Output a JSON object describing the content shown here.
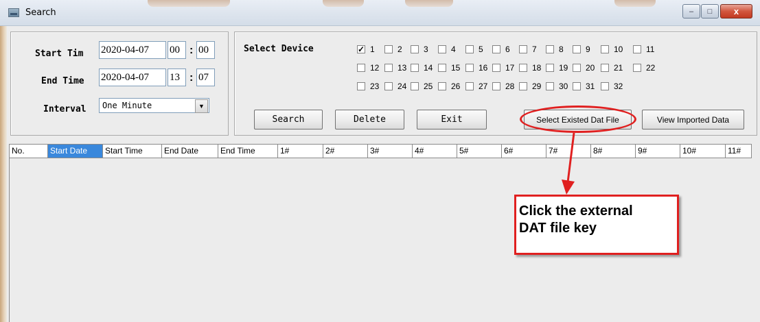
{
  "window": {
    "title": "Search",
    "minimize": "–",
    "maximize": "□",
    "close": "x"
  },
  "time_panel": {
    "start_label": "Start Tim",
    "start_date": "2020-04-07",
    "start_hour": "00",
    "start_minute": "00",
    "end_label": "End Time",
    "end_date": "2020-04-07",
    "end_hour": "13",
    "end_minute": "07",
    "colon": ":",
    "interval_label": "Interval",
    "interval_value": "One Minute",
    "dropdown_arrow": "▼"
  },
  "device_panel": {
    "label": "Select Device",
    "devices": [
      {
        "n": "1",
        "checked": true
      },
      {
        "n": "2",
        "checked": false
      },
      {
        "n": "3",
        "checked": false
      },
      {
        "n": "4",
        "checked": false
      },
      {
        "n": "5",
        "checked": false
      },
      {
        "n": "6",
        "checked": false
      },
      {
        "n": "7",
        "checked": false
      },
      {
        "n": "8",
        "checked": false
      },
      {
        "n": "9",
        "checked": false
      },
      {
        "n": "10",
        "checked": false
      },
      {
        "n": "11",
        "checked": false
      },
      {
        "n": "12",
        "checked": false
      },
      {
        "n": "13",
        "checked": false
      },
      {
        "n": "14",
        "checked": false
      },
      {
        "n": "15",
        "checked": false
      },
      {
        "n": "16",
        "checked": false
      },
      {
        "n": "17",
        "checked": false
      },
      {
        "n": "18",
        "checked": false
      },
      {
        "n": "19",
        "checked": false
      },
      {
        "n": "20",
        "checked": false
      },
      {
        "n": "21",
        "checked": false
      },
      {
        "n": "22",
        "checked": false
      },
      {
        "n": "23",
        "checked": false
      },
      {
        "n": "24",
        "checked": false
      },
      {
        "n": "25",
        "checked": false
      },
      {
        "n": "26",
        "checked": false
      },
      {
        "n": "27",
        "checked": false
      },
      {
        "n": "28",
        "checked": false
      },
      {
        "n": "29",
        "checked": false
      },
      {
        "n": "30",
        "checked": false
      },
      {
        "n": "31",
        "checked": false
      },
      {
        "n": "32",
        "checked": false
      }
    ],
    "check_mark": "✓"
  },
  "buttons": {
    "search": "Search",
    "delete": "Delete",
    "exit": "Exit",
    "select_dat": "Select Existed Dat File",
    "view_imported": "View Imported Data"
  },
  "table": {
    "columns": [
      "No.",
      "Start Date",
      "Start Time",
      "End Date",
      "End Time",
      "1#",
      "2#",
      "3#",
      "4#",
      "5#",
      "6#",
      "7#",
      "8#",
      "9#",
      "10#",
      "11#"
    ],
    "selected_column": "Start Date"
  },
  "annotation": {
    "line1": "Click the external",
    "line2": "DAT file key",
    "color": "#e02020"
  }
}
